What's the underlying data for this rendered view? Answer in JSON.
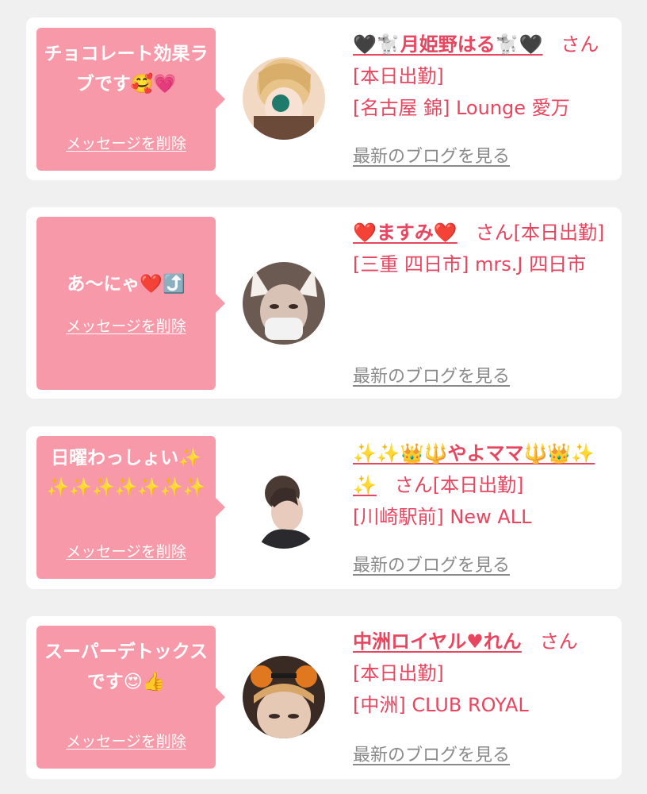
{
  "items": [
    {
      "message": "チョコレート効果ラブです🥰💗",
      "delete_label": "メッセージを削除",
      "cast_name": "🖤🐩月姫野はる🐩🖤",
      "san": "さん",
      "status": "[本日出勤]",
      "shop": "[名古屋 錦] Lounge 愛万",
      "blog_label": "最新のブログを見る"
    },
    {
      "message": "あ〜にゃ❤️⤴️",
      "delete_label": "メッセージを削除",
      "cast_name": "❤️ますみ❤️",
      "san": "さん",
      "status": "[本日出勤]",
      "shop": "[三重 四日市] mrs.J 四日市",
      "blog_label": "最新のブログを見る"
    },
    {
      "message": "日曜わっしょい✨✨✨✨✨✨✨✨",
      "delete_label": "メッセージを削除",
      "cast_name": "✨✨👑🔱やよママ🔱👑✨✨",
      "san": "さん",
      "status": "[本日出勤]",
      "shop": "[川崎駅前] New ALL",
      "blog_label": "最新のブログを見る"
    },
    {
      "message": "スーパーデトックスです😍👍",
      "delete_label": "メッセージを削除",
      "cast_name": "中洲ロイヤル♥れん",
      "san": "さん",
      "status": "[本日出勤]",
      "shop": "[中洲] CLUB ROYAL",
      "blog_label": "最新のブログを見る"
    }
  ],
  "colors": {
    "background": "#f0f0f0",
    "bubble": "#f799a8",
    "accent_text": "#e8455f",
    "link_gray": "#8a8a8a"
  }
}
